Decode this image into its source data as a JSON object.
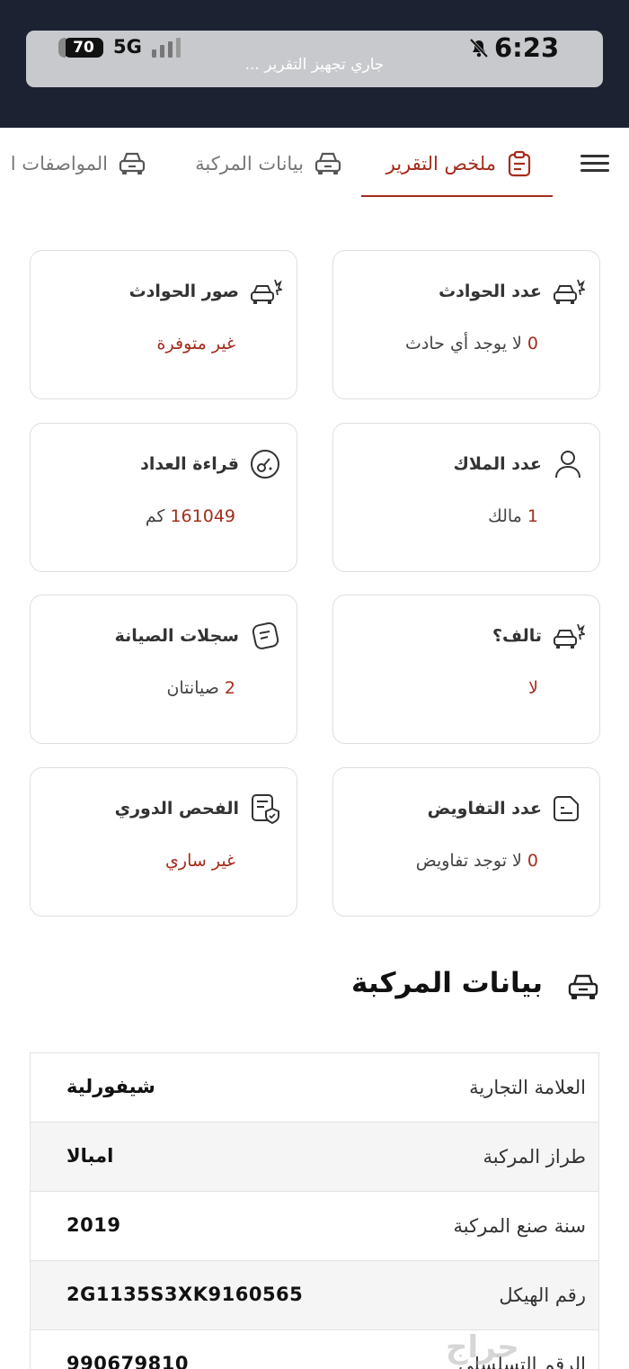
{
  "status_bar": {
    "battery": "70",
    "network": "5G",
    "time": "6:23",
    "banner": "جاري تجهيز التقرير ..."
  },
  "tabs": [
    {
      "label": "ملخص التقرير",
      "icon": "clipboard-icon",
      "active": true
    },
    {
      "label": "بيانات المركبة",
      "icon": "car-icon",
      "active": false
    },
    {
      "label": "المواصفات ا",
      "icon": "car-icon",
      "active": false
    }
  ],
  "cards": {
    "accidents_count": {
      "title": "عدد الحوادث",
      "num": "0",
      "text": " لا يوجد أي حادث"
    },
    "accident_photos": {
      "title": "صور الحوادث",
      "text": "غير متوفرة"
    },
    "owners_count": {
      "title": "عدد الملاك",
      "num": "1",
      "text": " مالك"
    },
    "odometer": {
      "title": "قراءة العداد",
      "num": "161049",
      "text": " كم"
    },
    "damaged": {
      "title": "تالف؟",
      "text": "لا"
    },
    "maintenance": {
      "title": "سجلات الصيانة",
      "num": "2",
      "text": " صيانتان"
    },
    "mandates_count": {
      "title": "عدد التفاويض",
      "num": "0",
      "text": " لا توجد تفاويض"
    },
    "inspection": {
      "title": "الفحص الدوري",
      "text": "غير ساري"
    }
  },
  "section": {
    "title": "بيانات المركبة"
  },
  "vehicle_table": [
    {
      "label": "العلامة التجارية",
      "value": "شيفورلية"
    },
    {
      "label": "طراز المركبة",
      "value": "امبالا"
    },
    {
      "label": "سنة صنع المركبة",
      "value": "2019"
    },
    {
      "label": "رقم الهيكل",
      "value": "2G1135S3XK9160565"
    },
    {
      "label": "الرقم التسلسلي",
      "value": "990679810"
    }
  ],
  "watermark": "حراج",
  "colors": {
    "accent": "#a42d1c",
    "header_bg": "#1d2233"
  }
}
